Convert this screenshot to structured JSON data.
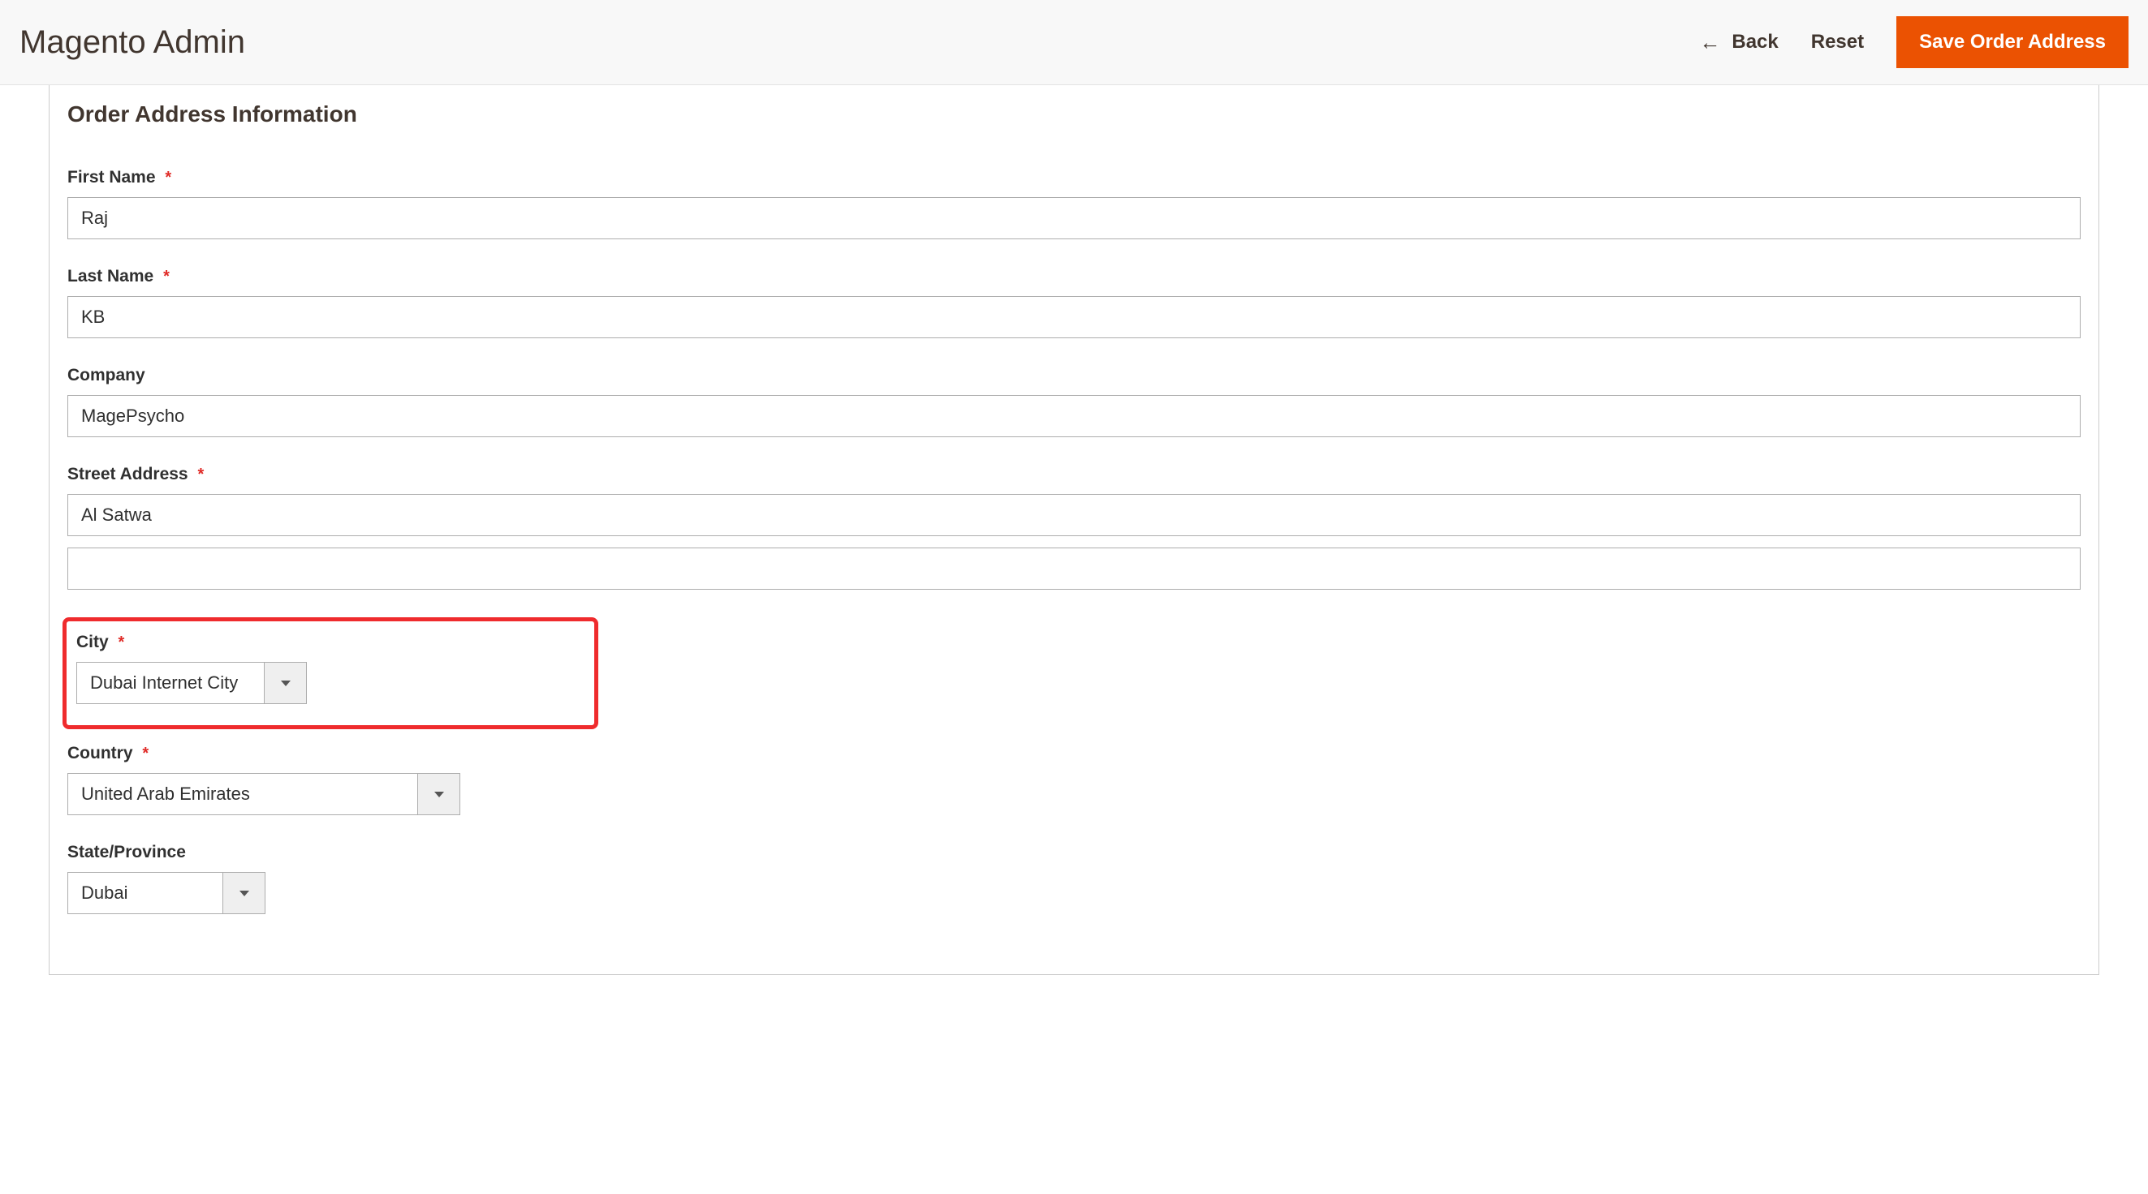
{
  "header": {
    "title": "Magento Admin",
    "back_label": "Back",
    "reset_label": "Reset",
    "save_label": "Save Order Address"
  },
  "section": {
    "title": "Order Address Information"
  },
  "fields": {
    "first_name": {
      "label": "First Name",
      "value": "Raj",
      "required": true
    },
    "last_name": {
      "label": "Last Name",
      "value": "KB",
      "required": true
    },
    "company": {
      "label": "Company",
      "value": "MagePsycho",
      "required": false
    },
    "street": {
      "label": "Street Address",
      "value1": "Al Satwa",
      "value2": "",
      "required": true
    },
    "city": {
      "label": "City",
      "value": "Dubai Internet City",
      "required": true
    },
    "country": {
      "label": "Country",
      "value": "United Arab Emirates",
      "required": true
    },
    "state": {
      "label": "State/Province",
      "value": "Dubai",
      "required": false
    }
  }
}
